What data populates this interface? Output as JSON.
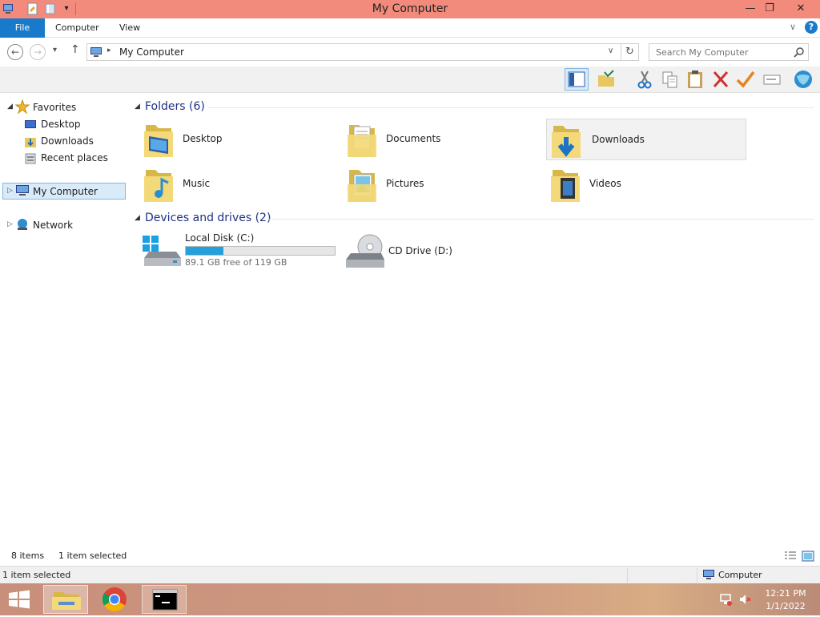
{
  "window": {
    "title": "My Computer"
  },
  "ribbon": {
    "tabs": [
      "File",
      "Computer",
      "View"
    ]
  },
  "address": {
    "path": "My Computer",
    "search_placeholder": "Search My Computer"
  },
  "sidebar": {
    "favorites": "Favorites",
    "fav_items": [
      "Desktop",
      "Downloads",
      "Recent places"
    ],
    "my_computer": "My Computer",
    "network": "Network"
  },
  "folders": {
    "header": "Folders (6)",
    "items": [
      "Desktop",
      "Documents",
      "Downloads",
      "Music",
      "Pictures",
      "Videos"
    ]
  },
  "drives": {
    "header": "Devices and drives (2)",
    "c_name": "Local Disk (C:)",
    "c_free": "89.1 GB free of 119 GB",
    "c_used_fraction": 0.25,
    "d_name": "CD Drive (D:)"
  },
  "status": {
    "items": "8 items",
    "selected": "1 item selected",
    "bottom_left": "1 item selected",
    "bottom_right": "Computer"
  },
  "clock": {
    "time": "12:21 PM",
    "date": "1/1/2022"
  },
  "colors": {
    "accent": "#1979ca",
    "title": "#f28b7b",
    "group_header": "#1e3287"
  }
}
